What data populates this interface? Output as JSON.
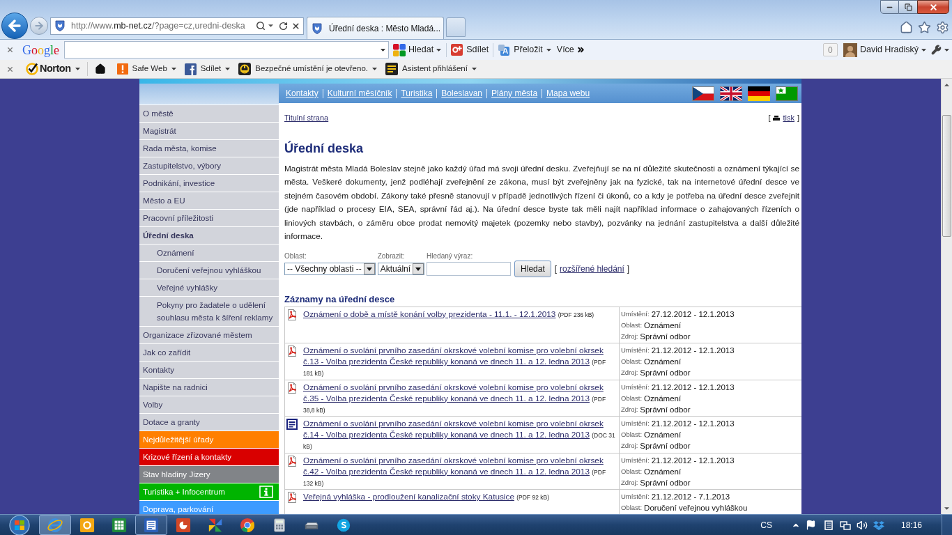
{
  "browser": {
    "address": {
      "scheme": "http://www.",
      "domain": "mb-net.cz",
      "path": "/?page=cz,uredni-deska"
    },
    "tabs": [
      {
        "title": "Úřední deska : Město Mladá...",
        "selected": true
      }
    ]
  },
  "google_toolbar": {
    "logo": "Google",
    "search_button": "Hledat",
    "share": "Sdílet",
    "translate": "Přeložit",
    "more": "Více",
    "counter": "0",
    "user": "David Hradiský"
  },
  "norton_toolbar": {
    "logo": "Norton",
    "items": [
      "Safe Web",
      "Sdílet",
      "Bezpečné umístění je otevřeno.",
      "Asistent přihlášení"
    ]
  },
  "site_nav": {
    "links": [
      "Kontakty",
      "Kulturní měsíčník",
      "Turistika",
      "Boleslavan",
      "Plány města",
      "Mapa webu"
    ]
  },
  "sidebar": {
    "items": [
      {
        "label": "O městě",
        "kind": "page",
        "selected": false
      },
      {
        "label": "Magistrát",
        "kind": "page",
        "selected": false
      },
      {
        "label": "Rada města, komise",
        "kind": "page",
        "selected": false
      },
      {
        "label": "Zastupitelstvo, výbory",
        "kind": "page",
        "selected": false
      },
      {
        "label": "Podnikání, investice",
        "kind": "page",
        "selected": false
      },
      {
        "label": "Město a EU",
        "kind": "page",
        "selected": false
      },
      {
        "label": "Pracovní příležitosti",
        "kind": "page",
        "selected": false
      },
      {
        "label": "Úřední deska",
        "kind": "page",
        "selected": true,
        "children": [
          {
            "label": "Oznámení",
            "kind": "page",
            "selected": false
          },
          {
            "label": "Doručení veřejnou vyhláškou",
            "kind": "page",
            "selected": false
          },
          {
            "label": "Veřejné vyhlášky",
            "kind": "page",
            "selected": false
          },
          {
            "label": "Pokyny pro žadatele o udělení souhlasu města k šíření reklamy",
            "kind": "page",
            "selected": false
          }
        ]
      },
      {
        "label": "Organizace zřizované městem",
        "kind": "page",
        "selected": false
      },
      {
        "label": "Jak co zařídit",
        "kind": "page",
        "selected": false
      },
      {
        "label": "Kontakty",
        "kind": "page",
        "selected": false
      },
      {
        "label": "Napište na radnici",
        "kind": "page",
        "selected": false
      },
      {
        "label": "Volby",
        "kind": "page",
        "selected": false
      },
      {
        "label": "Dotace a granty",
        "kind": "page",
        "selected": false
      },
      {
        "label": "Nejdůležitější úřady",
        "kind": "feature",
        "selected": false,
        "color": "#ff7f00"
      },
      {
        "label": "Krizové řízení a kontakty",
        "kind": "feature",
        "selected": false,
        "color": "#d90000"
      },
      {
        "label": "Stav hladiny Jizery",
        "kind": "feature",
        "selected": false,
        "color": "#818488"
      },
      {
        "label": "Turistika + Infocentrum",
        "kind": "info",
        "selected": false,
        "color": "#00b400"
      },
      {
        "label": "Doprava, parkování",
        "kind": "feature",
        "selected": false,
        "color": "#3d9bff"
      }
    ]
  },
  "content": {
    "breadcrumb": "Titulní strana",
    "print": {
      "open": "[",
      "label": "tisk",
      "close": "]"
    },
    "heading": "Úřední deska",
    "intro": "Magistrát města Mladá Boleslav stejně jako každý úřad má svoji úřední desku. Zveřejňují se na ní důležité skutečnosti a oznámení týkající se města. Veškeré dokumenty, jenž podléhají zveřejnění ze zákona, musí být zveřejněny jak na fyzické, tak na internetové úřední desce ve stejném časovém období. Zákony také přesně stanovují v případě jednotlivých řízení či úkonů, co a kdy je potřeba na úřední desce zveřejnit (jde například o procesy EIA, SEA, správní řád aj.). Na úřední desce byste tak měli najít například informace o zahajovaných řízeních o liniových stavbách, o záměru obce prodat nemovitý majetek (pozemky nebo stavby), pozvánky na jednání zastupitelstva a další důležité informace.",
    "search": {
      "area": {
        "label": "Oblast:",
        "value": "-- Všechny oblasti --"
      },
      "show": {
        "label": "Zobrazit:",
        "value": "Aktuální"
      },
      "query": {
        "label": "Hledaný výraz:"
      },
      "button": "Hledat",
      "advanced": {
        "open": "[",
        "label": "rozšířené hledání",
        "close": "]"
      }
    },
    "records": {
      "title": "Záznamy na úřední desce",
      "rows": [
        {
          "kind": "pdf",
          "title": "Oznámení o době a místě konání volby prezidenta - 11.1. - 12.1.2013",
          "size": "(PDF 236 kB)",
          "details": [
            {
              "label": "Umístění:",
              "value": "27.12.2012 - 12.1.2013"
            },
            {
              "label": "Oblast:",
              "value": "Oznámení"
            },
            {
              "label": "Zdroj:",
              "value": "Správní odbor"
            }
          ]
        },
        {
          "kind": "pdf",
          "title": "Oznámení o svolání prvního zasedání okrskové volební komise pro volební okrsek č.13 - Volba prezidenta České republiky konaná ve dnech 11. a 12. ledna 2013",
          "size": "(PDF 181 kB)",
          "details": [
            {
              "label": "Umístění:",
              "value": "21.12.2012 - 12.1.2013"
            },
            {
              "label": "Oblast:",
              "value": "Oznámení"
            },
            {
              "label": "Zdroj:",
              "value": "Správní odbor"
            }
          ]
        },
        {
          "kind": "pdf",
          "title": "Oznámení o svolání prvního zasedání okrskové volební komise pro volební okrsek č.35 - Volba prezidenta České republiky konaná ve dnech 11. a 12. ledna 2013",
          "size": "(PDF 38,8 kB)",
          "details": [
            {
              "label": "Umístění:",
              "value": "21.12.2012 - 12.1.2013"
            },
            {
              "label": "Oblast:",
              "value": "Oznámení"
            },
            {
              "label": "Zdroj:",
              "value": "Správní odbor"
            }
          ]
        },
        {
          "kind": "doc",
          "title": "Oznámení o svolání prvního zasedání okrskové volební komise pro volební okrsek č.14 - Volba prezidenta České republiky konaná ve dnech 11. a 12. ledna 2013",
          "size": "(DOC 31 kB)",
          "details": [
            {
              "label": "Umístění:",
              "value": "21.12.2012 - 12.1.2013"
            },
            {
              "label": "Oblast:",
              "value": "Oznámení"
            },
            {
              "label": "Zdroj:",
              "value": "Správní odbor"
            }
          ]
        },
        {
          "kind": "pdf",
          "title": "Oznámení o svolání prvního zasedání okrskové volební komise pro volební okrsek č.42 - Volba prezidenta České republiky konaná ve dnech 11. a 12. ledna 2013",
          "size": "(PDF 132 kB)",
          "details": [
            {
              "label": "Umístění:",
              "value": "21.12.2012 - 12.1.2013"
            },
            {
              "label": "Oblast:",
              "value": "Oznámení"
            },
            {
              "label": "Zdroj:",
              "value": "Správní odbor"
            }
          ]
        },
        {
          "kind": "pdf",
          "title": "Veřejná vyhláška - prodloužení kanalizační stoky Katusice",
          "size": "(PDF 92 kB)",
          "details": [
            {
              "label": "Umístění:",
              "value": "21.12.2012 - 7.1.2013"
            },
            {
              "label": "Oblast:",
              "value": "Doručení veřejnou vyhláškou"
            }
          ]
        }
      ]
    }
  },
  "taskbar": {
    "apps": [
      {
        "selected": true,
        "running": true
      },
      {
        "selected": false,
        "running": false
      },
      {
        "selected": false,
        "running": false
      },
      {
        "selected": false,
        "running": true
      },
      {
        "selected": false,
        "running": false
      },
      {
        "selected": false,
        "running": false
      },
      {
        "selected": false,
        "running": false
      },
      {
        "selected": false,
        "running": false
      },
      {
        "selected": false,
        "running": false
      },
      {
        "selected": false,
        "running": false
      }
    ],
    "language": "CS",
    "clock": "18:16"
  }
}
